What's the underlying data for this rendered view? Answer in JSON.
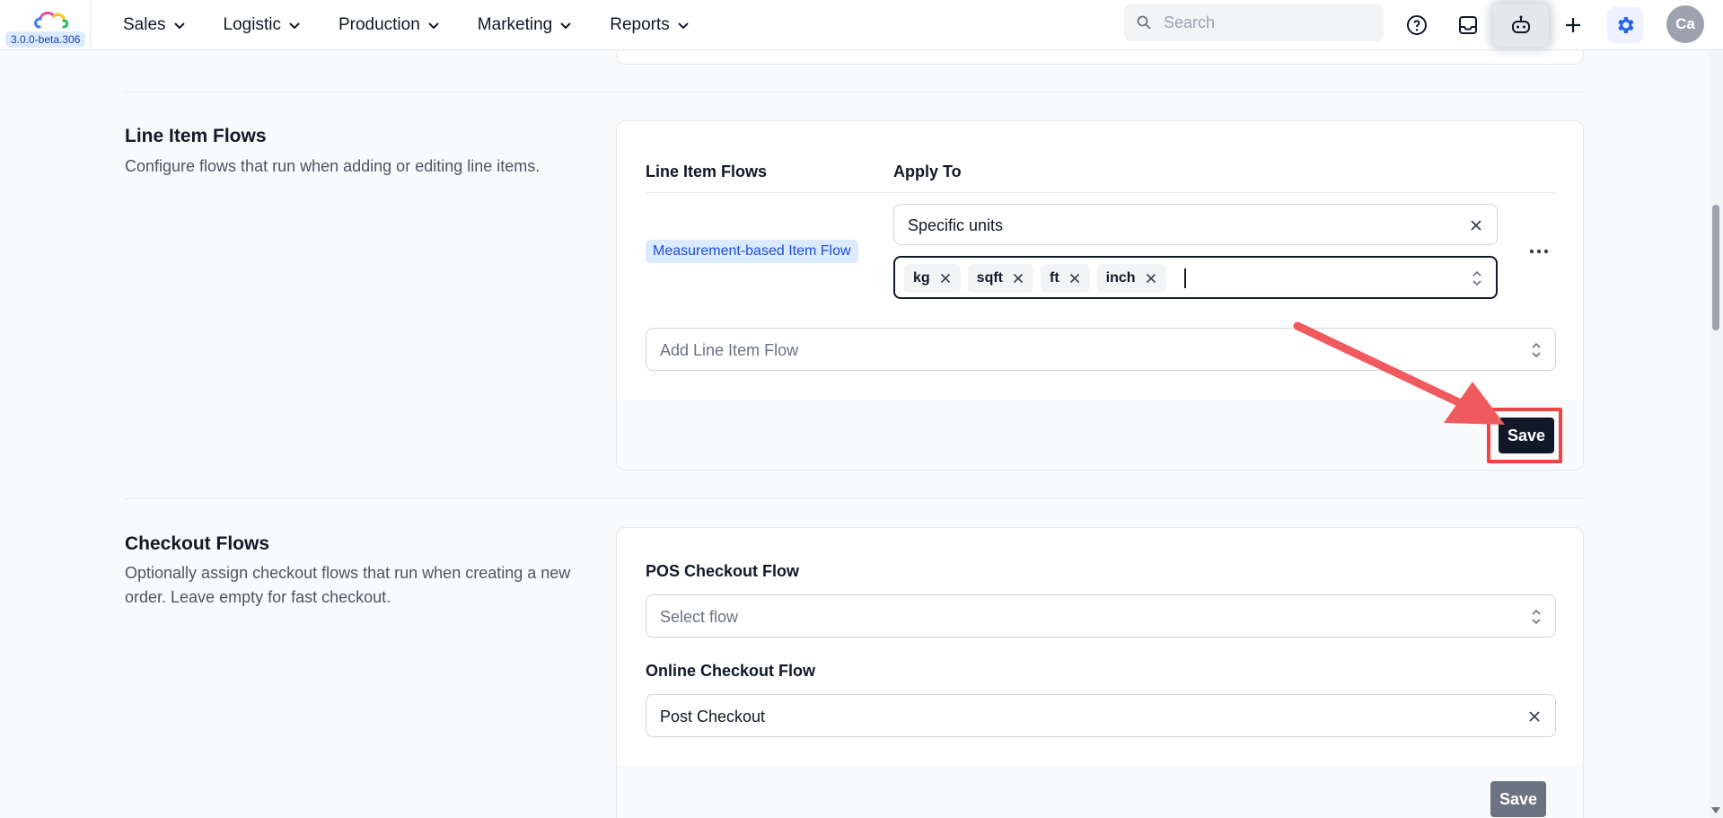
{
  "app": {
    "version": "3.0.0-beta.306",
    "colors": {
      "accent": "#2563eb",
      "annotation": "#ef4444",
      "primary_button": "#111827"
    }
  },
  "nav": {
    "items": [
      {
        "label": "Sales"
      },
      {
        "label": "Logistic"
      },
      {
        "label": "Production"
      },
      {
        "label": "Marketing"
      },
      {
        "label": "Reports"
      }
    ]
  },
  "search": {
    "placeholder": "Search",
    "icon": "search-icon"
  },
  "toolbar": {
    "icons": [
      "help-icon",
      "inbox-icon",
      "ai-assistant-icon",
      "plus-icon",
      "gear-icon"
    ],
    "avatar_initials": "Ca"
  },
  "line_item_flows": {
    "title": "Line Item Flows",
    "description": "Configure flows that run when adding or editing line items.",
    "columns": {
      "flow": "Line Item Flows",
      "apply_to": "Apply To"
    },
    "rows": [
      {
        "flow": "Measurement-based Item Flow",
        "apply_to": "Specific units",
        "units": [
          "kg",
          "sqft",
          "ft",
          "inch"
        ]
      }
    ],
    "add_placeholder": "Add Line Item Flow",
    "save_label": "Save"
  },
  "checkout_flows": {
    "title": "Checkout Flows",
    "description": "Optionally assign checkout flows that run when creating a new order. Leave empty for fast checkout.",
    "pos": {
      "label": "POS Checkout Flow",
      "placeholder": "Select flow"
    },
    "online": {
      "label": "Online Checkout Flow",
      "value": "Post Checkout"
    },
    "save_label": "Save"
  }
}
